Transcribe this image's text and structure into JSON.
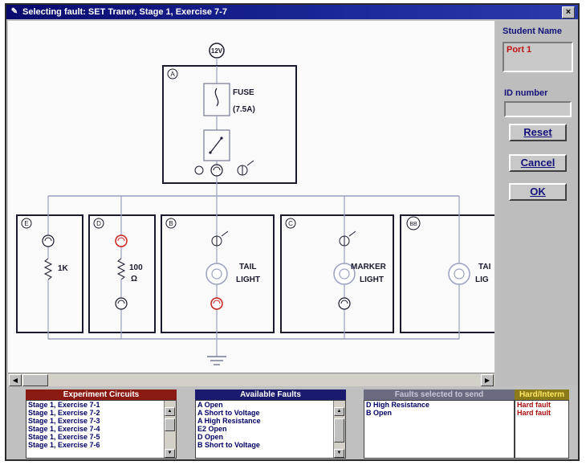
{
  "window": {
    "title": "Selecting fault: SET Traner, Stage 1, Exercise 7-7",
    "close": "×"
  },
  "circuit": {
    "supply": "12V",
    "block_a": {
      "letter": "A",
      "fuse_label": "FUSE",
      "fuse_rating": "(7.5A)"
    },
    "block_e": {
      "letter": "E",
      "resistor": "1K"
    },
    "block_d": {
      "letter": "D",
      "resistor_top": "100",
      "resistor_bottom": "Ω"
    },
    "block_b": {
      "letter": "B",
      "lamp_top": "TAIL",
      "lamp_bottom": "LIGHT"
    },
    "block_c": {
      "letter": "C",
      "lamp_top": "MARKER",
      "lamp_bottom": "LIGHT"
    },
    "block_bb": {
      "letter": "BB",
      "lamp_top": "TAI",
      "lamp_bottom": "LIG"
    }
  },
  "right_panel": {
    "student_name_label": "Student Name",
    "student_name_value": "Port 1",
    "id_label": "ID number",
    "id_value": "",
    "reset_button": "Reset",
    "cancel_button": "Cancel",
    "ok_button": "OK"
  },
  "lists": {
    "experiment_circuits": {
      "header": "Experiment Circuits",
      "items": [
        "Stage 1, Exercise 7-1",
        "Stage 1, Exercise 7-2",
        "Stage 1, Exercise 7-3",
        "Stage 1, Exercise 7-4",
        "Stage 1, Exercise 7-5",
        "Stage 1, Exercise 7-6"
      ]
    },
    "available_faults": {
      "header": "Available Faults",
      "items": [
        "A Open",
        "A Short to Voltage",
        "A High Resistance",
        "E2 Open",
        "D Open",
        "B Short to Voltage"
      ]
    },
    "faults_selected": {
      "header": "Faults selected to send",
      "items": [
        "D High Resistance",
        "B Open"
      ]
    },
    "hard_intermittent": {
      "header": "Hard/Interm",
      "items": [
        "Hard fault",
        "Hard fault"
      ]
    }
  },
  "colors": {
    "wire": "#9aa0c0",
    "box": "#1a1a2e",
    "fault": "#c8201a",
    "title_bar": "#0a0a6e"
  }
}
